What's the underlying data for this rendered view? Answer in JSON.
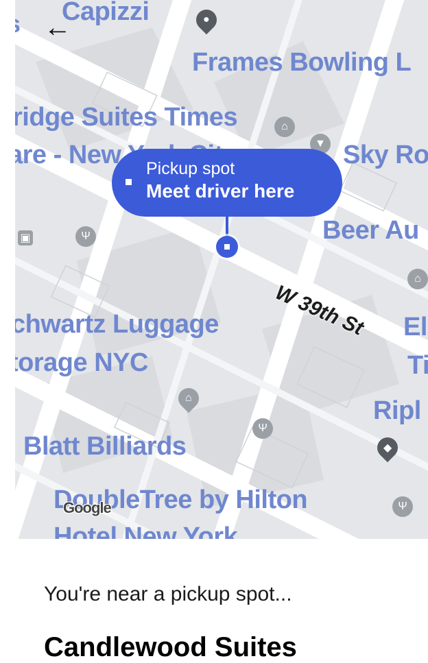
{
  "map": {
    "labels": [
      "s",
      "Capizzi",
      "Frames Bowling L",
      "ridge Suites Times",
      "are - New York City",
      "Sky Ro",
      "Beer Au",
      "chwartz Luggage",
      "torage NYC",
      "El",
      "Ti",
      "Ripl",
      "Blatt Billiards",
      "DoubleTree by Hilton",
      "Hotel New York"
    ],
    "street": "W 39th St",
    "attribution": "Google",
    "colors": {
      "map_bg": "#e5e7ea",
      "label": "#6f87cf",
      "accent": "#3c5bd9"
    }
  },
  "nav": {
    "back_icon": "←"
  },
  "pickup": {
    "line1": "Pickup spot",
    "line2": "Meet driver here"
  },
  "poi_icons": {
    "pin": "●",
    "hotel": "⌂",
    "restaurant": "Ψ",
    "shop": "⌂",
    "bar": "▼",
    "attraction": "◆",
    "transit": "▣"
  },
  "bottom": {
    "status": "You're near a pickup spot...",
    "place_title": "Candlewood Suites"
  }
}
